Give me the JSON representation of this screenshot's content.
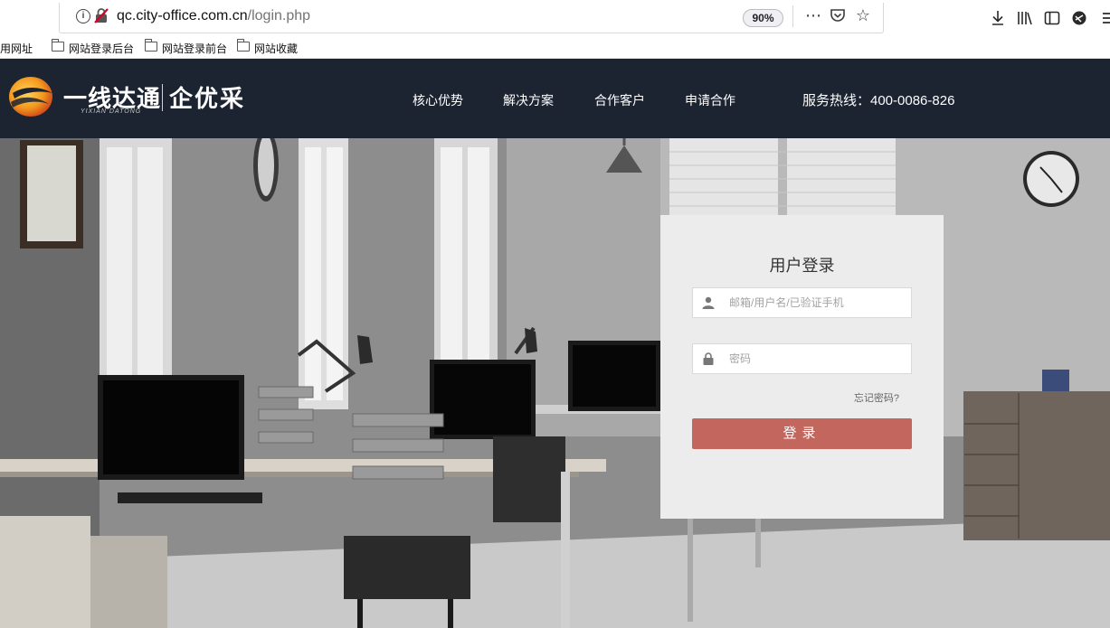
{
  "browser": {
    "url_host": "qc.city-office.com.cn",
    "url_path": "/login.php",
    "zoom": "90%",
    "page_actions": {
      "more_icon": "ellipsis-icon",
      "pocket_icon": "pocket-icon",
      "bookmark_icon": "star-icon"
    },
    "toolbar": {
      "download_icon": "download-icon",
      "library_icon": "library-icon",
      "sidebar_icon": "sidebar-icon",
      "extension_icon": "extension-icon",
      "menu_icon": "menu-icon"
    }
  },
  "bookmarks": {
    "items": [
      {
        "label": "用网址",
        "folder": false
      },
      {
        "label": "网站登录后台",
        "folder": true
      },
      {
        "label": "网站登录前台",
        "folder": true
      },
      {
        "label": "网站收藏",
        "folder": true
      }
    ]
  },
  "header": {
    "logo_cn": "一线达通",
    "logo_pinyin": "YIXIAN DATONG",
    "brand": "企优采",
    "nav": [
      {
        "label": "核心优势"
      },
      {
        "label": "解决方案"
      },
      {
        "label": "合作客户"
      },
      {
        "label": "申请合作"
      }
    ],
    "hotline": "服务热线：400-0086-826"
  },
  "login": {
    "title": "用户登录",
    "username_placeholder": "邮箱/用户名/已验证手机",
    "username_value": "",
    "password_placeholder": "密码",
    "password_value": "",
    "forgot_label": "忘记密码?",
    "submit_label": "登录"
  },
  "colors": {
    "header_bg": "#1c2331",
    "login_button": "#c2665e",
    "panel_bg": "#ececec"
  }
}
